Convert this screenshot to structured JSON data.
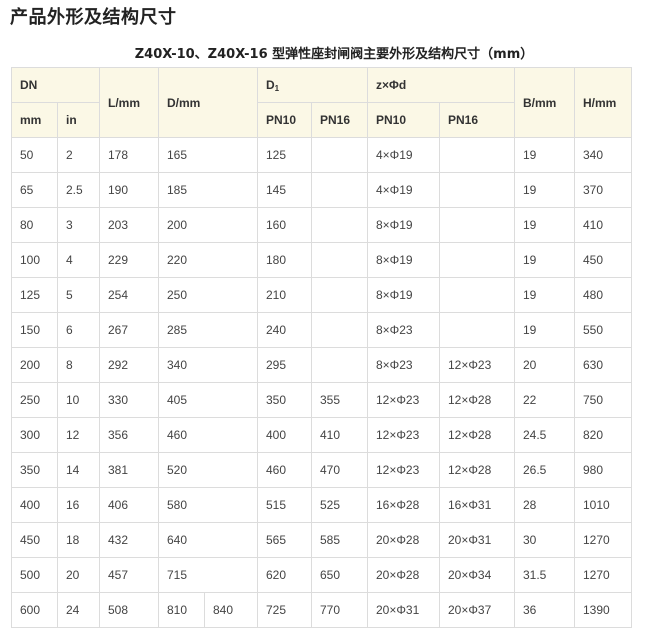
{
  "page_heading": "产品外形及结构尺寸",
  "table_caption": "Z40X-10、Z40X-16 型弹性座封闸阀主要外形及结构尺寸（mm）",
  "headers": {
    "dn": "DN",
    "mm": "mm",
    "in": "in",
    "l": "L/mm",
    "d": "D/mm",
    "d1_main": "D",
    "d1_sub": "1",
    "zd": "z×Φd",
    "pn10_a": "PN10",
    "pn16_a": "PN16",
    "pn10_b": "PN10",
    "pn16_b": "PN16",
    "b": "B/mm",
    "h": "H/mm"
  },
  "rows": [
    {
      "mm": "50",
      "in": "2",
      "l": "178",
      "d": "165",
      "d1_pn10": "125",
      "d1_pn16": "",
      "zd_pn10": "4×Φ19",
      "zd_pn16": "",
      "b": "19",
      "h": "340"
    },
    {
      "mm": "65",
      "in": "2.5",
      "l": "190",
      "d": "185",
      "d1_pn10": "145",
      "d1_pn16": "",
      "zd_pn10": "4×Φ19",
      "zd_pn16": "",
      "b": "19",
      "h": "370"
    },
    {
      "mm": "80",
      "in": "3",
      "l": "203",
      "d": "200",
      "d1_pn10": "160",
      "d1_pn16": "",
      "zd_pn10": "8×Φ19",
      "zd_pn16": "",
      "b": "19",
      "h": "410"
    },
    {
      "mm": "100",
      "in": "4",
      "l": "229",
      "d": "220",
      "d1_pn10": "180",
      "d1_pn16": "",
      "zd_pn10": "8×Φ19",
      "zd_pn16": "",
      "b": "19",
      "h": "450"
    },
    {
      "mm": "125",
      "in": "5",
      "l": "254",
      "d": "250",
      "d1_pn10": "210",
      "d1_pn16": "",
      "zd_pn10": "8×Φ19",
      "zd_pn16": "",
      "b": "19",
      "h": "480"
    },
    {
      "mm": "150",
      "in": "6",
      "l": "267",
      "d": "285",
      "d1_pn10": "240",
      "d1_pn16": "",
      "zd_pn10": "8×Φ23",
      "zd_pn16": "",
      "b": "19",
      "h": "550"
    },
    {
      "mm": "200",
      "in": "8",
      "l": "292",
      "d": "340",
      "d1_pn10": "295",
      "d1_pn16": "",
      "zd_pn10": "8×Φ23",
      "zd_pn16": "12×Φ23",
      "b": "20",
      "h": "630"
    },
    {
      "mm": "250",
      "in": "10",
      "l": "330",
      "d": "405",
      "d1_pn10": "350",
      "d1_pn16": "355",
      "zd_pn10": "12×Φ23",
      "zd_pn16": "12×Φ28",
      "b": "22",
      "h": "750"
    },
    {
      "mm": "300",
      "in": "12",
      "l": "356",
      "d": "460",
      "d1_pn10": "400",
      "d1_pn16": "410",
      "zd_pn10": "12×Φ23",
      "zd_pn16": "12×Φ28",
      "b": "24.5",
      "h": "820"
    },
    {
      "mm": "350",
      "in": "14",
      "l": "381",
      "d": "520",
      "d1_pn10": "460",
      "d1_pn16": "470",
      "zd_pn10": "12×Φ23",
      "zd_pn16": "12×Φ28",
      "b": "26.5",
      "h": "980"
    },
    {
      "mm": "400",
      "in": "16",
      "l": "406",
      "d": "580",
      "d1_pn10": "515",
      "d1_pn16": "525",
      "zd_pn10": "16×Φ28",
      "zd_pn16": "16×Φ31",
      "b": "28",
      "h": "1010"
    },
    {
      "mm": "450",
      "in": "18",
      "l": "432",
      "d": "640",
      "d1_pn10": "565",
      "d1_pn16": "585",
      "zd_pn10": "20×Φ28",
      "zd_pn16": "20×Φ31",
      "b": "30",
      "h": "1270"
    },
    {
      "mm": "500",
      "in": "20",
      "l": "457",
      "d": "715",
      "d1_pn10": "620",
      "d1_pn16": "650",
      "zd_pn10": "20×Φ28",
      "zd_pn16": "20×Φ34",
      "b": "31.5",
      "h": "1270"
    }
  ],
  "last_row": {
    "mm": "600",
    "in": "24",
    "l": "508",
    "d_a": "810",
    "d_b": "840",
    "d1_pn10": "725",
    "d1_pn16": "770",
    "zd_pn10": "20×Φ31",
    "zd_pn16": "20×Φ37",
    "b": "36",
    "h": "1390"
  }
}
